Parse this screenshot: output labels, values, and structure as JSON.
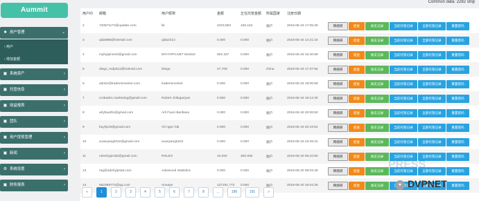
{
  "brand": "Aummit",
  "topbar": {
    "common_data": "Common data:  2282 strip"
  },
  "sidebar": {
    "user_mgmt": "用户管理",
    "sub_user": "› 用户",
    "sub_recharge": "› 增加金额",
    "items": [
      "系统资产",
      "托管信息",
      "收益报表",
      "团队",
      "用户提现管理",
      "新闻",
      "系统设置",
      "财务报表"
    ]
  },
  "table": {
    "headers": [
      "用户ID",
      "邮箱",
      "用户昵称",
      "金额",
      "正在托管金额",
      "所属国家",
      "注册日期"
    ],
    "buttons": {
      "view": "网络研",
      "withdraw": "提金",
      "income": "收支记录",
      "current": "当前托管记录",
      "all": "全部托管记录",
      "reset": "重置密码"
    },
    "rows": [
      [
        "2",
        "740571173@update.com",
        "kk",
        "4323.863",
        "165.153",
        "顺户",
        "2018-06-19 17:05:26"
      ],
      [
        "3",
        "qida888@hotmail.com",
        "qida2213",
        "0.000",
        "0.000",
        "顺户",
        "2018-06-15 12:21:15"
      ],
      [
        "4",
        "myhyipinvest@gmail.com",
        "MYHYIPs.NET Monitor",
        "502.337",
        "0.000",
        "顺户",
        "2018-06-19 16:40:58"
      ],
      [
        "5",
        "diego_mdp011@hotmail.com",
        "Diego",
        "27.709",
        "0.000",
        "china",
        "2018-06-19 17:37:55"
      ],
      [
        "6",
        "admin@tradersmonitor.com",
        "tradersmonitor",
        "0.000",
        "0.000",
        "顺户",
        "2018-06-19 18:05:58"
      ],
      [
        "7",
        "crobads1.marketing@gmail.com",
        "Robert chilegariyan",
        "0.000",
        "0.000",
        "顺户",
        "2018-06-19 18:12:30"
      ],
      [
        "8",
        "arlyfaud91@gmail.com",
        "Arli Fauzi Bariliana",
        "0.000",
        "0.000",
        "顺户",
        "2018-06-19 20:06:50"
      ],
      [
        "9",
        "buyhp19@gmail.com",
        "Vũ ngọc hải",
        "0.000",
        "0.000",
        "顺户",
        "2018-06-19 20:19:54"
      ],
      [
        "10",
        "xuanyang0222@gmail.com",
        "xuanyang0222",
        "0.000",
        "0.000",
        "顺户",
        "2018-06-19 23:49:31"
      ],
      [
        "11",
        "rolexhyipclub@gmail.com",
        "ROLEX",
        "10.200",
        "300.000",
        "顺户",
        "2018-06-20 05:10:50"
      ],
      [
        "13",
        "reg@advhyipstat.com",
        "Advanced Statistics",
        "0.000",
        "0.000",
        "顺户",
        "2018-06-20 08:03:49"
      ],
      [
        "14",
        "562399772@qq.com",
        "Annaye",
        "127191.773",
        "0.000",
        "顺户",
        "2018-06-20 16:04:26"
      ]
    ]
  },
  "pager": {
    "prev": "«",
    "next": "»",
    "pages": [
      "1",
      "2",
      "3",
      "4",
      "5",
      "6",
      "7",
      "8",
      "...",
      "190",
      "191"
    ],
    "active": "1"
  },
  "watermark": {
    "brand": "DVPNET",
    "ghost": "PRESS"
  }
}
